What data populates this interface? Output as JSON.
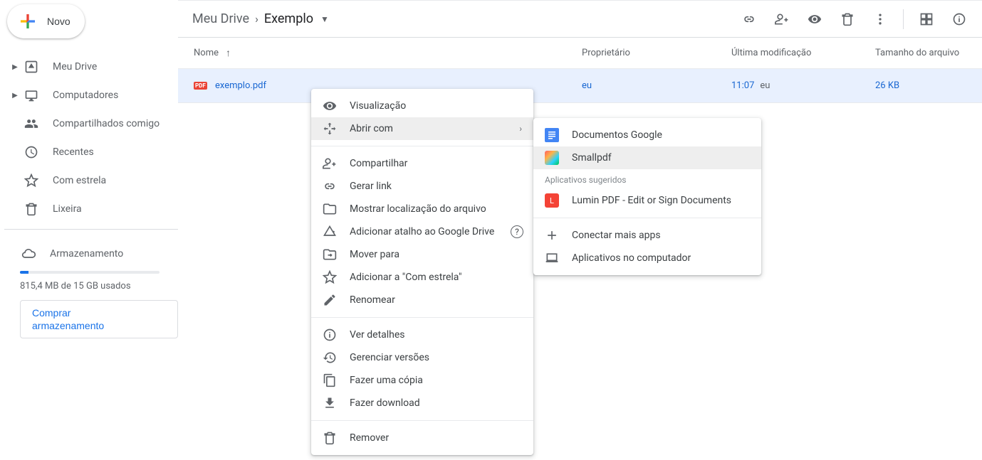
{
  "sidebar": {
    "new_btn": "Novo",
    "items": [
      {
        "label": "Meu Drive",
        "has_arrow": true,
        "icon": "drive"
      },
      {
        "label": "Computadores",
        "has_arrow": true,
        "icon": "computers"
      },
      {
        "label": "Compartilhados comigo",
        "has_arrow": false,
        "icon": "shared"
      },
      {
        "label": "Recentes",
        "has_arrow": false,
        "icon": "clock"
      },
      {
        "label": "Com estrela",
        "has_arrow": false,
        "icon": "star"
      },
      {
        "label": "Lixeira",
        "has_arrow": false,
        "icon": "trash"
      }
    ],
    "storage_label": "Armazenamento",
    "storage_usage": "815,4 MB de 15 GB usados",
    "buy_label": "Comprar armazenamento"
  },
  "breadcrumb": {
    "root": "Meu Drive",
    "folder": "Exemplo"
  },
  "table": {
    "cols": {
      "name": "Nome",
      "owner": "Proprietário",
      "mod": "Última modificação",
      "size": "Tamanho do arquivo"
    },
    "row": {
      "name": "exemplo.pdf",
      "owner": "eu",
      "mod_time": "11:07",
      "mod_by": "eu",
      "size": "26 KB"
    }
  },
  "ctx": {
    "preview": "Visualização",
    "open_with": "Abrir com",
    "share": "Compartilhar",
    "get_link": "Gerar link",
    "show_loc": "Mostrar localização do arquivo",
    "add_shortcut": "Adicionar atalho ao Google Drive",
    "move": "Mover para",
    "star": "Adicionar a \"Com estrela\"",
    "rename": "Renomear",
    "details": "Ver detalhes",
    "versions": "Gerenciar versões",
    "copy": "Fazer uma cópia",
    "download": "Fazer download",
    "remove": "Remover"
  },
  "submenu": {
    "docs": "Documentos Google",
    "smallpdf": "Smallpdf",
    "suggested": "Aplicativos sugeridos",
    "lumin": "Lumin PDF - Edit or Sign Documents",
    "more_apps": "Conectar mais apps",
    "desktop": "Aplicativos no computador"
  }
}
